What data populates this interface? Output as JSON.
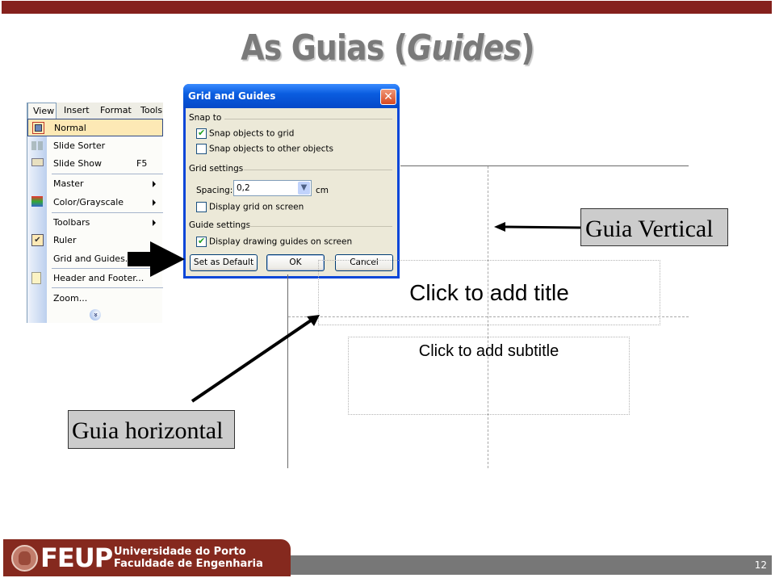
{
  "slide": {
    "title_plain": "As Guias (",
    "title_italic": "Guides",
    "title_close": ")",
    "page_number": "12",
    "brand_color": "#85211d"
  },
  "menu": {
    "menubar": [
      "View",
      "Insert",
      "Format",
      "Tools"
    ],
    "items": [
      {
        "label": "Normal",
        "icon": "normal-view-icon",
        "highlighted": true
      },
      {
        "label": "Slide Sorter",
        "icon": "slide-sorter-icon"
      },
      {
        "label": "Slide Show",
        "icon": "slide-show-icon",
        "shortcut": "F5"
      },
      {
        "label": "Master",
        "submenu": true
      },
      {
        "label": "Color/Grayscale",
        "icon": "color-grayscale-icon",
        "submenu": true
      },
      {
        "label": "Toolbars",
        "submenu": true
      },
      {
        "label": "Ruler",
        "icon": "check-icon",
        "checked": true
      },
      {
        "label": "Grid and Guides..."
      },
      {
        "label": "Header and Footer...",
        "icon": "header-footer-icon"
      },
      {
        "label": "Zoom..."
      }
    ],
    "expand_glyph": "»"
  },
  "dialog": {
    "title": "Grid and Guides",
    "close_glyph": "✕",
    "snap_group": "Snap to",
    "snap_grid": {
      "label": "Snap objects to grid",
      "checked": true
    },
    "snap_objects": {
      "label": "Snap objects to other objects",
      "checked": false
    },
    "grid_group": "Grid settings",
    "spacing_label": "Spacing:",
    "spacing_value": "0,2",
    "spacing_unit": "cm",
    "display_grid": {
      "label": "Display grid on screen",
      "checked": false
    },
    "guide_group": "Guide settings",
    "display_guides": {
      "label": "Display drawing guides on screen",
      "checked": true
    },
    "buttons": {
      "set_default": "Set as Default",
      "ok": "OK",
      "cancel": "Cancel"
    }
  },
  "canvas": {
    "title_placeholder": "Click to add title",
    "subtitle_placeholder": "Click to add subtitle"
  },
  "callouts": {
    "vertical": "Guia Vertical",
    "horizontal": "Guia horizontal"
  },
  "footer": {
    "logo_text": "FEUP",
    "university": "Universidade do Porto",
    "faculty": "Faculdade de Engenharia"
  }
}
